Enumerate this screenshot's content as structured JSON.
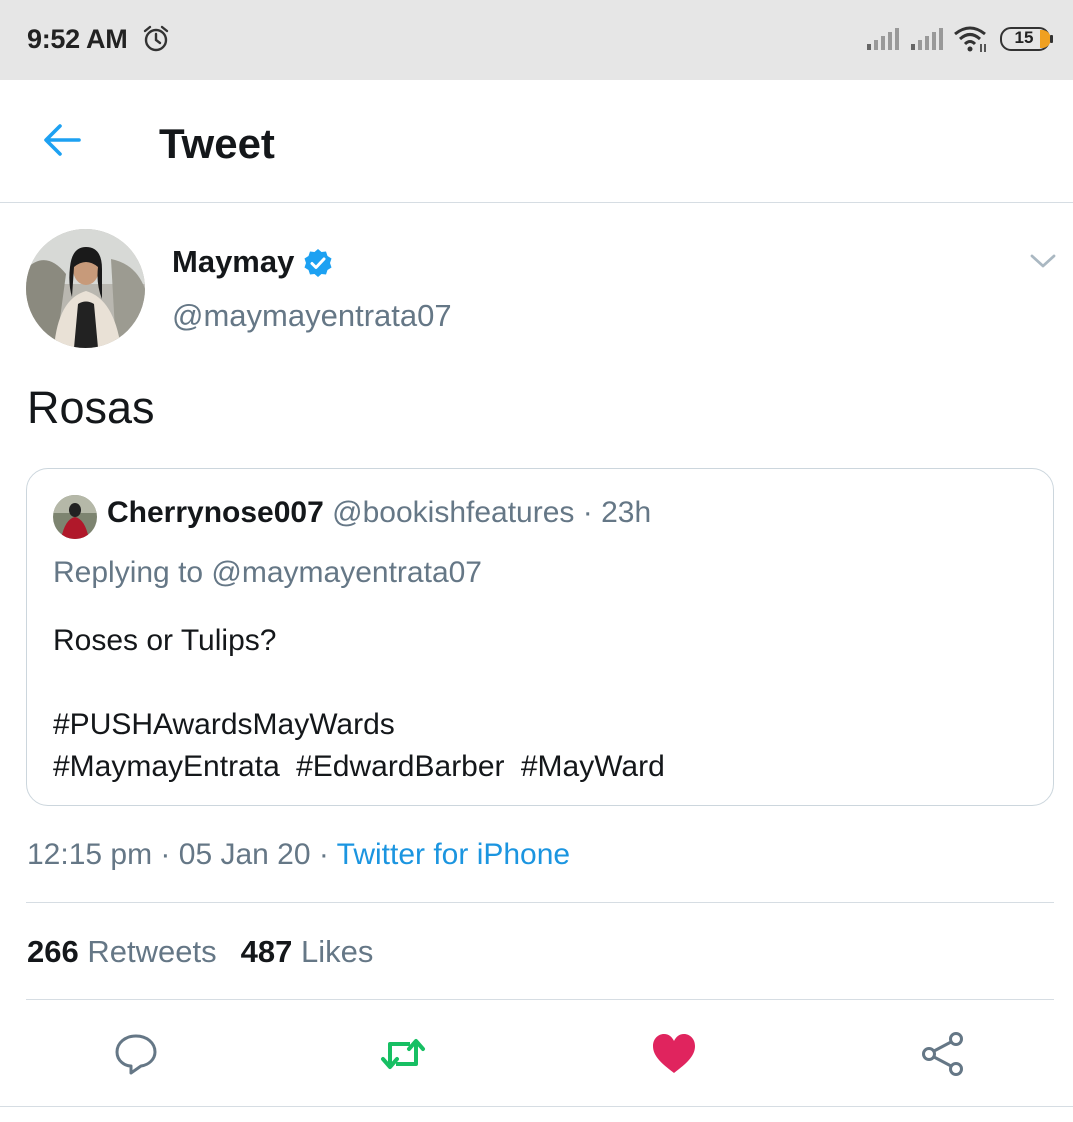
{
  "status_bar": {
    "time": "9:52 AM",
    "battery": "15",
    "icons": [
      "alarm-icon",
      "signal-icon",
      "signal-icon",
      "wifi-icon",
      "battery-icon"
    ]
  },
  "header": {
    "title": "Tweet",
    "back_icon": "back-arrow-icon"
  },
  "tweet": {
    "author_name": "Maymay",
    "author_handle": "@maymayentrata07",
    "verified": true,
    "text": "Rosas",
    "timestamp": "12:15 pm",
    "date": "05 Jan 20",
    "separator": " · ",
    "source": "Twitter for iPhone",
    "retweets_count": "266",
    "retweets_label": "Retweets",
    "likes_count": "487",
    "likes_label": "Likes",
    "liked": true
  },
  "quoted": {
    "name": "Cherrynose007",
    "handle": "@bookishfeatures",
    "time": "· 23h",
    "replying_to": "Replying to @maymayentrata07",
    "body": "Roses or Tulips?",
    "tags_line1": "#PUSHAwardsMayWards",
    "tags_line2": "#MaymayEntrata  #EdwardBarber  #MayWard"
  },
  "actions": [
    "reply-icon",
    "retweet-icon",
    "like-icon",
    "share-icon"
  ],
  "colors": {
    "accent": "#1da1f2",
    "link": "#1b95e0",
    "secondary_text": "#657786",
    "retweet": "#17bf63",
    "like": "#e0245e",
    "status_bar_bg": "#e6e6e6"
  }
}
